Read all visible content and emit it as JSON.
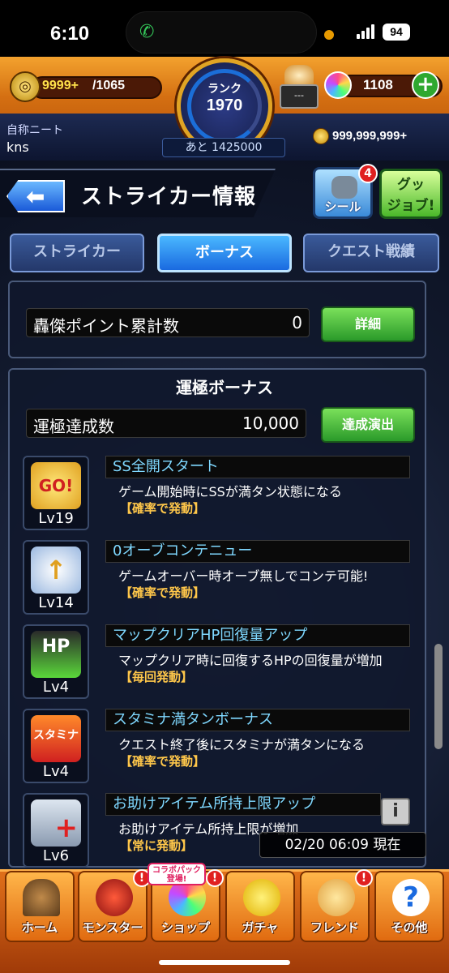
{
  "status": {
    "time": "6:10",
    "battery": "94"
  },
  "top": {
    "stamina_current": "9999+",
    "stamina_max": "/1065",
    "rank_label": "ランク",
    "rank_value": "1970",
    "rank_next": "あと 1425000",
    "robot_value": "---",
    "orbs": "1108",
    "nickname_title": "自称ニート",
    "username": "kns",
    "coins": "999,999,999+"
  },
  "header": {
    "title": "ストライカー情報",
    "seal_label": "シール",
    "seal_badge": "4",
    "goods_label": "グッ\nジョブ!"
  },
  "tabs": [
    {
      "label": "ストライカー"
    },
    {
      "label": "ボーナス"
    },
    {
      "label": "クエスト戦績"
    }
  ],
  "points": {
    "label": "轟傑ポイント累計数",
    "value": "0",
    "button": "詳細"
  },
  "luck": {
    "title": "運極ボーナス",
    "count_label": "運極達成数",
    "count_value": "10,000",
    "button": "達成演出",
    "items": [
      {
        "name": "SS全開スタート",
        "desc": "ゲーム開始時にSSが満タン状態になる",
        "cond": "【確率で発動】",
        "lv": "Lv19",
        "icon": "go-icon",
        "art": "GO!"
      },
      {
        "name": "0オーブコンテニュー",
        "desc": "ゲームオーバー時オーブ無しでコンテ可能!",
        "cond": "【確率で発動】",
        "lv": "Lv14",
        "icon": "wing-arrow-icon",
        "art": "↑"
      },
      {
        "name": "マップクリアHP回復量アップ",
        "desc": "マップクリア時に回復するHPの回復量が増加",
        "cond": "【毎回発動】",
        "lv": "Lv4",
        "icon": "hp-up-icon",
        "art": "HP"
      },
      {
        "name": "スタミナ満タンボーナス",
        "desc": "クエスト終了後にスタミナが満タンになる",
        "cond": "【確率で発動】",
        "lv": "Lv4",
        "icon": "stamina-icon",
        "art": "スタミナ"
      },
      {
        "name": "お助けアイテム所持上限アップ",
        "desc": "お助けアイテム所持上限が増加",
        "cond": "【常に発動】",
        "lv": "Lv6",
        "icon": "item-plus-icon",
        "art": "+"
      }
    ]
  },
  "timestamp": "02/20 06:09 現在",
  "collab": "コラボパック\n登場!",
  "nav": [
    {
      "label": "ホーム",
      "icon": "home-icon"
    },
    {
      "label": "モンスター",
      "icon": "monster-icon"
    },
    {
      "label": "ショップ",
      "icon": "shop-icon"
    },
    {
      "label": "ガチャ",
      "icon": "gacha-icon"
    },
    {
      "label": "フレンド",
      "icon": "friend-icon"
    },
    {
      "label": "その他",
      "icon": "other-icon"
    }
  ],
  "nav_alert": "!",
  "colors": {
    "accent": "#1a6ae0",
    "orange": "#e06a10",
    "cond": "#ffc74a",
    "bonus_title": "#7fd8ff"
  }
}
